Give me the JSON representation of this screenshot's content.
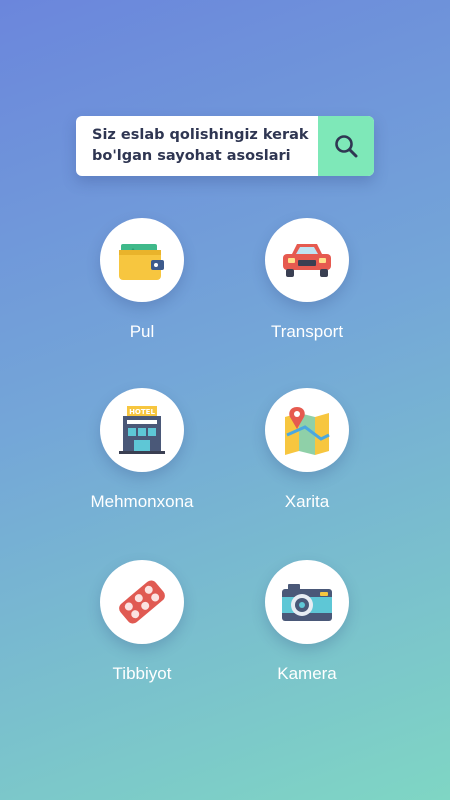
{
  "search": {
    "line1": "Siz eslab qolishingiz kerak",
    "line2": "bo'lgan sayohat asoslari"
  },
  "grid": {
    "items": [
      {
        "label": "Pul",
        "icon": "wallet-icon"
      },
      {
        "label": "Transport",
        "icon": "car-icon"
      },
      {
        "label": "Mehmonxona",
        "icon": "hotel-icon"
      },
      {
        "label": "Xarita",
        "icon": "map-icon"
      },
      {
        "label": "Tibbiyot",
        "icon": "pills-icon"
      },
      {
        "label": "Kamera",
        "icon": "camera-icon"
      }
    ]
  },
  "hotel_sign": "HOTEL",
  "colors": {
    "accent": "#7ee8b8",
    "gradient_top": "#6b86dc",
    "gradient_bottom": "#7fd6c4"
  }
}
